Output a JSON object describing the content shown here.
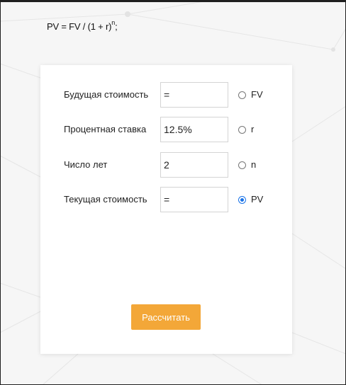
{
  "formula": {
    "base": "PV = FV / (1 + r)",
    "exponent": "n",
    "suffix": ";"
  },
  "form": {
    "rows": [
      {
        "label": "Будущая стоимость",
        "value": "=",
        "radio_label": "FV",
        "selected": false
      },
      {
        "label": "Процентная ставка",
        "value": "12.5%",
        "radio_label": "r",
        "selected": false
      },
      {
        "label": "Число лет",
        "value": "2",
        "radio_label": "n",
        "selected": false
      },
      {
        "label": "Текущая стоимость",
        "value": "=",
        "radio_label": "PV",
        "selected": true
      }
    ],
    "button_label": "Рассчитать"
  },
  "colors": {
    "accent": "#f3a738",
    "radio_selected": "#1a73e8"
  }
}
